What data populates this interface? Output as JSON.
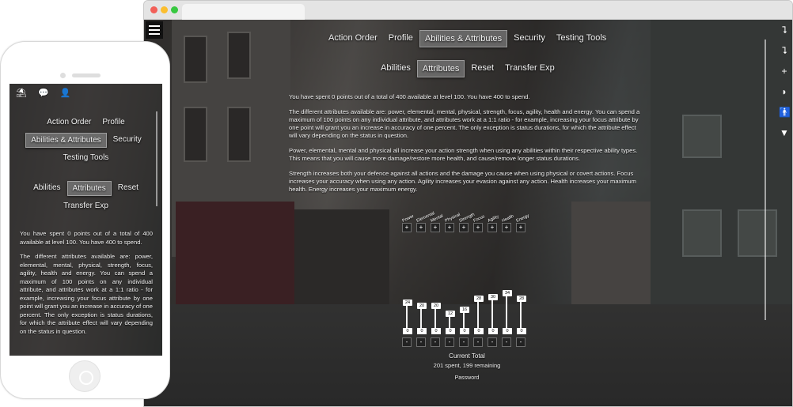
{
  "desktop": {
    "nav_primary": [
      "Action Order",
      "Profile",
      "Abilities & Attributes",
      "Security",
      "Testing Tools"
    ],
    "nav_secondary": [
      "Abilities",
      "Attributes",
      "Reset",
      "Transfer Exp"
    ],
    "paragraphs": [
      "You have spent 0 points out of a total of 400 available at level 100. You have 400 to spend.",
      "The different attributes available are: power, elemental, mental, physical, strength, focus, agility, health and energy. You can spend a maximum of 100 points on any individual attribute, and attributes work at a 1:1 ratio - for example, increasing your focus attribute by one point will grant you an increase in accuracy of one percent. The only exception is status durations, for which the attribute effect will vary depending on the status in question.",
      "Power, elemental, mental and physical all increase your action strength when using any abilities within their respective ability types. This means that you will cause more damage/restore more health, and cause/remove longer status durations.",
      "Strength increases both your defence against all actions and the damage you cause when using physical or covert actions. Focus increases your accuracy when using any action. Agility increases your evasion against any action. Health increases your maximum health. Energy increases your maximum energy."
    ],
    "attributes": [
      "Power",
      "Elemental",
      "Mental",
      "Physical",
      "Strength",
      "Focus",
      "Agility",
      "Health",
      "Energy"
    ],
    "plus_label": "+",
    "minus_label": "-",
    "bar_values": [
      24,
      20,
      20,
      12,
      16,
      28,
      30,
      34,
      28
    ],
    "spent_values": [
      "0",
      "0",
      "0",
      "0",
      "0",
      "0",
      "0",
      "0",
      "0"
    ],
    "current_total_label": "Current Total",
    "spent_remaining": "201 spent, 199 remaining",
    "password_label": "Password",
    "right_icons": [
      "exit-icon",
      "exit-alt-icon",
      "plus-icon",
      "bag-icon",
      "person-icon",
      "map-pin-icon"
    ]
  },
  "mobile": {
    "icons": [
      "beach-umbrella-icon",
      "chat-icon",
      "user-icon"
    ],
    "nav_primary": [
      "Action Order",
      "Profile",
      "Abilities & Attributes",
      "Security",
      "Testing Tools"
    ],
    "nav_secondary": [
      "Abilities",
      "Attributes",
      "Reset",
      "Transfer Exp"
    ],
    "paragraphs": [
      "You have spent 0 points out of a total of 400 available at level 100. You have 400 to spend.",
      "The different attributes available are: power, elemental, mental, physical, strength, focus, agility, health and energy. You can spend a maximum of 100 points on any individual attribute, and attributes work at a 1:1 ratio - for example, increasing your focus attribute by one point will grant you an increase in accuracy of one percent. The only exception is status durations, for which the attribute effect will vary depending on the status in question."
    ]
  }
}
